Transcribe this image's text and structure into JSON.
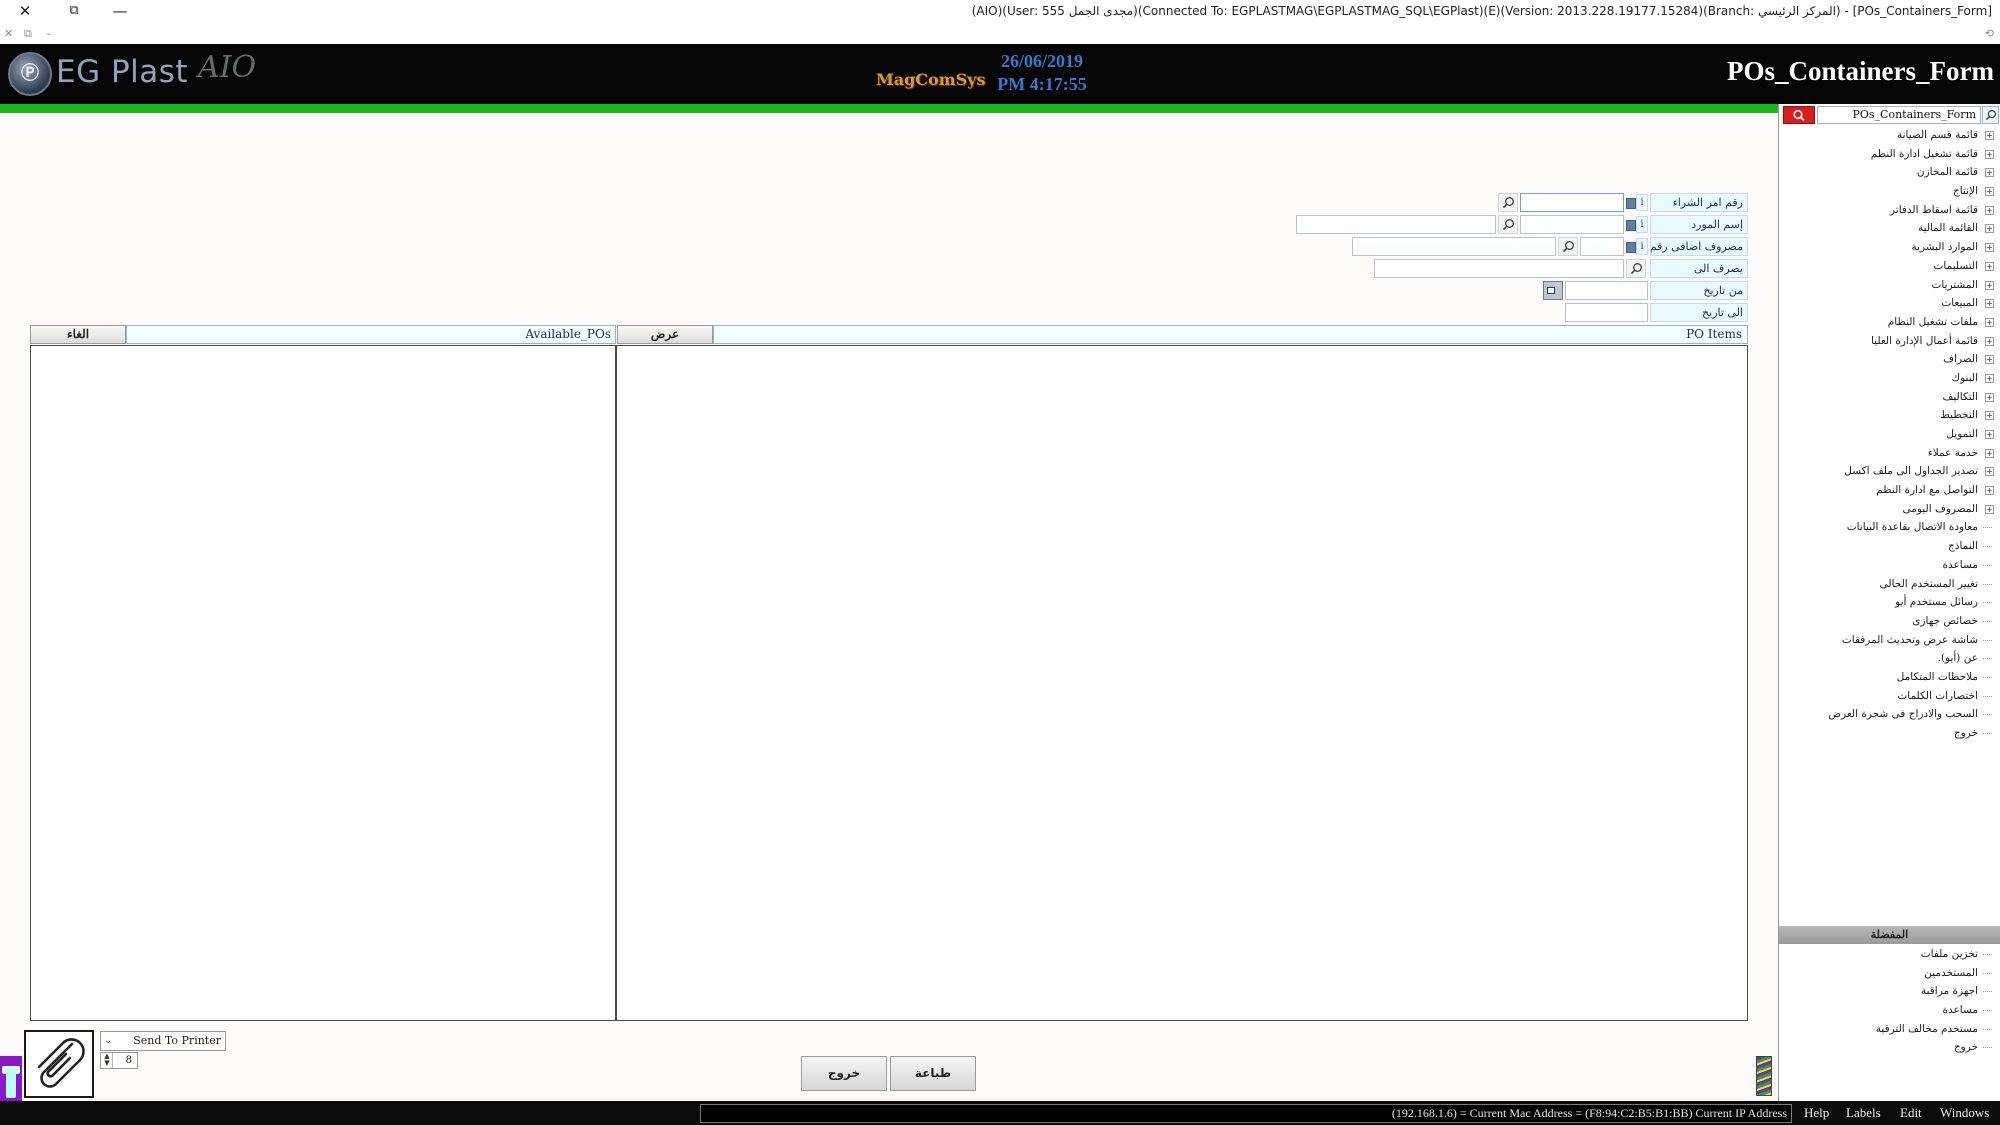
{
  "window": {
    "title": "[POs_Containers_Form] - (المركز الرئيسي :Branch)(Version: 2013.228.19177.15284)(E)(Connected To: EGPLASTMAG\\EGPLASTMAG_SQL\\EGPlast)(مجدى الجمل User: 555)(AIO)",
    "close_glyph": "✕",
    "restore_glyph": "⧉",
    "minimize_glyph": "—",
    "mdi_close": "✕",
    "mdi_restore": "⧉",
    "mdi_min": "–",
    "mdi_right": "⟲"
  },
  "header": {
    "logo_text": "EG Plast",
    "logo_suffix": "AIO",
    "brand": "MagComSys",
    "date": "26/06/2019",
    "time": "PM 4:17:55",
    "form_name": "POs_Containers_Form",
    "colors": {
      "background": "#050505",
      "clock": "#2f7cd1",
      "accent_bar": "#17b817"
    }
  },
  "form": {
    "po_number_label": "رقم امر الشراء",
    "supplier_name_label": "إسم المورد",
    "extra_expense_label": "مصروف اضافى رقم",
    "expense_to_label": "يصرف الى",
    "from_date_label": "من تاريخ",
    "to_date_label": "الى تاريخ",
    "info_marker": "i",
    "po_number_value": "",
    "supplier_code_value": "",
    "supplier_name_value": "",
    "extra_expense_no_value": "",
    "extra_expense_desc_value": "",
    "expense_to_value": "",
    "from_date_value": "",
    "to_date_value": ""
  },
  "grids": {
    "po_items_header": "PO Items",
    "show_button": "عرض",
    "available_pos_header": "Available_POs",
    "cancel_button": "الغاء"
  },
  "bottom": {
    "print_target": "Send To Printer",
    "copies": "8",
    "print_button": "طباعة",
    "exit_button": "خروج"
  },
  "statusbar": {
    "ip_info": "(192.168.1.6) = Current Mac Address = (F8:94:C2:B5:B1:BB) Current IP Address",
    "menu": [
      "Help",
      "Labels",
      "Edit",
      "Windows"
    ]
  },
  "sidebar": {
    "search_value": "POs_Containers_Form",
    "tree": [
      {
        "label": "قائمة قسم الصيانة",
        "expandable": true
      },
      {
        "label": "قائمة تشغيل ادارة النظم",
        "expandable": true
      },
      {
        "label": "قائمة المخازن",
        "expandable": true
      },
      {
        "label": "الإنتاج",
        "expandable": true
      },
      {
        "label": "قائمة اسقاط الدفاتر",
        "expandable": true
      },
      {
        "label": "القائمة المالية",
        "expandable": true
      },
      {
        "label": "الموارد البشرية",
        "expandable": true
      },
      {
        "label": "التسليمات",
        "expandable": true
      },
      {
        "label": "المشتريات",
        "expandable": true
      },
      {
        "label": "المبيعات",
        "expandable": true
      },
      {
        "label": "ملفات تشغيل النظام",
        "expandable": true
      },
      {
        "label": "قائمة أعمال الإدارة العليا",
        "expandable": true
      },
      {
        "label": "الصراف",
        "expandable": true
      },
      {
        "label": "البنوك",
        "expandable": true
      },
      {
        "label": "التكاليف",
        "expandable": true
      },
      {
        "label": "التخطيط",
        "expandable": true
      },
      {
        "label": "التمويل",
        "expandable": true
      },
      {
        "label": "خدمة عملاء",
        "expandable": true
      },
      {
        "label": "تصدير الجداول الى ملف اكسل",
        "expandable": true
      },
      {
        "label": "التواصل مع ادارة النظم",
        "expandable": true
      },
      {
        "label": "المصروف اليومى",
        "expandable": true
      },
      {
        "label": "معاودة الاتصال بقاعدة البيانات",
        "expandable": false
      },
      {
        "label": "النماذج",
        "expandable": false
      },
      {
        "label": "مساعدة",
        "expandable": false
      },
      {
        "label": "تغيير المستخدم الحالى",
        "expandable": false
      },
      {
        "label": "رسائل مستخدم أيو",
        "expandable": false
      },
      {
        "label": "خصائص جهازى",
        "expandable": false
      },
      {
        "label": "شاشة عرض وتحديث المرفقات",
        "expandable": false
      },
      {
        "label": "عن (أيو).",
        "expandable": false
      },
      {
        "label": "ملاحظات المتكامل",
        "expandable": false
      },
      {
        "label": "اختصارات الكلمات",
        "expandable": false
      },
      {
        "label": "السحب والادراج فى شجرة العرض",
        "expandable": false
      },
      {
        "label": "خروج",
        "expandable": false
      }
    ],
    "favorites_header": "المفضلة",
    "favorites": [
      "تخزين ملفات",
      "المستخدمين",
      "اجهزة مراقبة",
      "مساعدة",
      "مستخدم مخالف الترقية",
      "خروج"
    ]
  }
}
